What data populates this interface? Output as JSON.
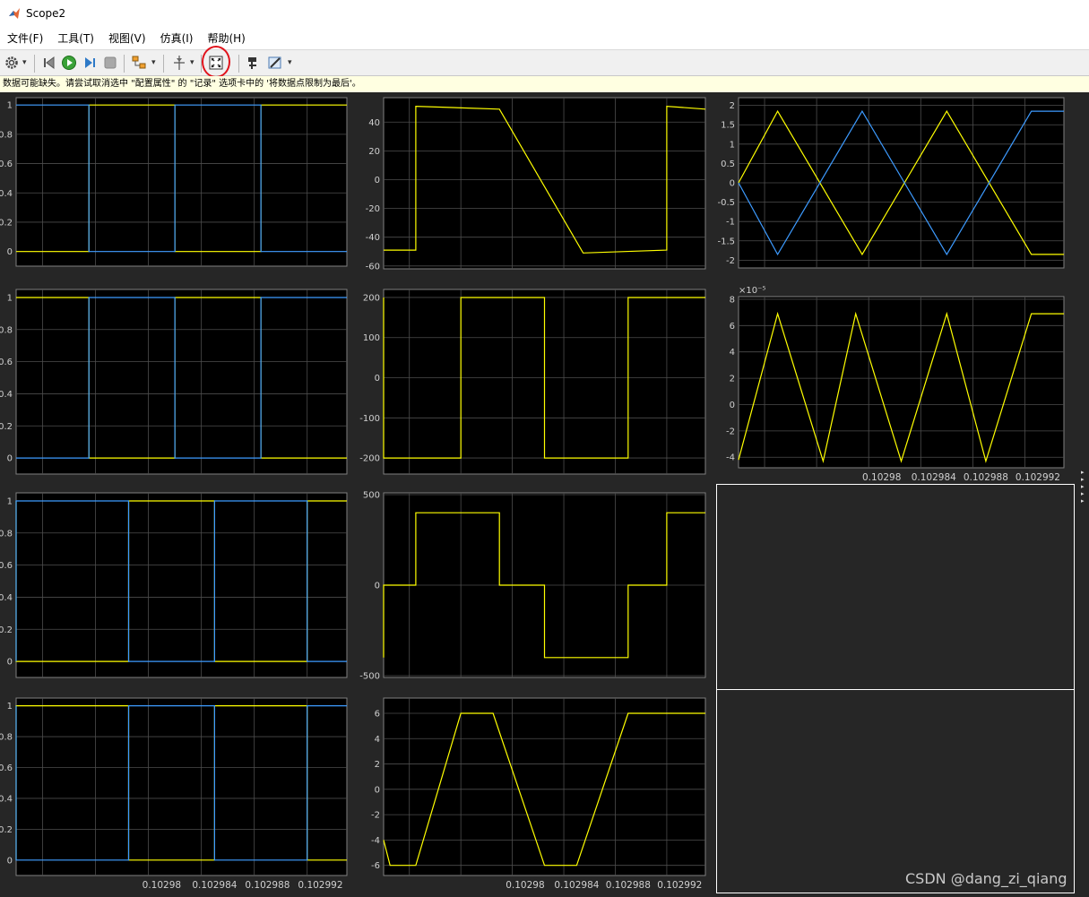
{
  "window": {
    "title": "Scope2"
  },
  "menu": [
    "文件(F)",
    "工具(T)",
    "视图(V)",
    "仿真(I)",
    "帮助(H)"
  ],
  "toolbar": {
    "icons": [
      "gear-icon",
      "step-back-icon",
      "run-icon",
      "step-forward-icon",
      "stop-icon",
      "signal-layout-icon",
      "cursor-measure-icon",
      "zoom-fit-icon",
      "highlight-block-icon",
      "style-icon"
    ]
  },
  "status_message": "数据可能缺失。请尝试取消选中 \"配置属性\" 的 \"记录\" 选项卡中的 '将数据点限制为最后'。",
  "colors": {
    "yellow": "#ffff00",
    "blue": "#3d9bff",
    "plot_bg": "#000000",
    "figure_bg": "#262626",
    "grid": "#4d4d4d",
    "tick_text": "#d0d0d0"
  },
  "watermark": "CSDN @dang_zi_qiang",
  "chart_data": [
    {
      "type": "line",
      "panel": "r1c1",
      "xlim": [
        0.102969,
        0.102994
      ],
      "ylim": [
        -0.1,
        1.05
      ],
      "yticks": [
        0,
        0.2,
        0.4,
        0.6,
        0.8,
        1
      ],
      "ytick_labels": [
        "0",
        "0.2",
        "0.4",
        "0.6",
        "0.8",
        "1"
      ],
      "xtick_labels": [],
      "series": [
        {
          "color": "#ffff00",
          "x": [
            0.102969,
            0.1029745,
            0.1029745,
            0.102981,
            0.102981,
            0.1029875,
            0.1029875,
            0.102994
          ],
          "y": [
            0,
            0,
            1,
            1,
            0,
            0,
            1,
            1
          ]
        },
        {
          "color": "#3d9bff",
          "x": [
            0.102969,
            0.1029745,
            0.1029745,
            0.102981,
            0.102981,
            0.1029875,
            0.1029875,
            0.102994
          ],
          "y": [
            1,
            1,
            0,
            0,
            1,
            1,
            0,
            0
          ]
        }
      ]
    },
    {
      "type": "line",
      "panel": "r1c2",
      "xlim": [
        0.102969,
        0.102994
      ],
      "ylim": [
        -62,
        57
      ],
      "yticks": [
        -60,
        -40,
        -20,
        0,
        20,
        40
      ],
      "ytick_labels": [
        "-60",
        "-40",
        "-20",
        "0",
        "20",
        "40"
      ],
      "xtick_labels": [],
      "series": [
        {
          "color": "#ffff00",
          "x": [
            0.102969,
            0.1029715,
            0.1029715,
            0.102978,
            0.102978,
            0.1029845,
            0.1029845,
            0.102991,
            0.102991,
            0.102994
          ],
          "y": [
            -49,
            -49,
            51,
            49,
            49,
            -51,
            -51,
            -49,
            51,
            49
          ]
        }
      ]
    },
    {
      "type": "line",
      "panel": "r1c3",
      "xlim": [
        0.102969,
        0.102994
      ],
      "ylim": [
        -2.2,
        2.2
      ],
      "yticks": [
        -2,
        -1.5,
        -1,
        -0.5,
        0,
        0.5,
        1,
        1.5,
        2
      ],
      "ytick_labels": [
        "-2",
        "-1.5",
        "-1",
        "-0.5",
        "0",
        "0.5",
        "1",
        "1.5",
        "2"
      ],
      "xtick_labels": [],
      "series": [
        {
          "color": "#ffff00",
          "x": [
            0.102969,
            0.102972,
            0.1029785,
            0.102985,
            0.1029915,
            0.102994
          ],
          "y": [
            0,
            1.85,
            -1.85,
            1.85,
            -1.85,
            -1.85
          ]
        },
        {
          "color": "#3d9bff",
          "x": [
            0.102969,
            0.102972,
            0.1029785,
            0.102985,
            0.1029915,
            0.102994
          ],
          "y": [
            0,
            -1.85,
            1.85,
            -1.85,
            1.85,
            1.85
          ]
        }
      ]
    },
    {
      "type": "line",
      "panel": "r2c1",
      "xlim": [
        0.102969,
        0.102994
      ],
      "ylim": [
        -0.1,
        1.05
      ],
      "yticks": [
        0,
        0.2,
        0.4,
        0.6,
        0.8,
        1
      ],
      "ytick_labels": [
        "0",
        "0.2",
        "0.4",
        "0.6",
        "0.8",
        "1"
      ],
      "xtick_labels": [],
      "series": [
        {
          "color": "#ffff00",
          "x": [
            0.102969,
            0.1029745,
            0.1029745,
            0.102981,
            0.102981,
            0.1029875,
            0.1029875,
            0.102994
          ],
          "y": [
            1,
            1,
            0,
            0,
            1,
            1,
            0,
            0
          ]
        },
        {
          "color": "#3d9bff",
          "x": [
            0.102969,
            0.1029745,
            0.1029745,
            0.102981,
            0.102981,
            0.1029875,
            0.1029875,
            0.102994
          ],
          "y": [
            0,
            0,
            1,
            1,
            0,
            0,
            1,
            1
          ]
        }
      ]
    },
    {
      "type": "line",
      "panel": "r2c2",
      "xlim": [
        0.102969,
        0.102994
      ],
      "ylim": [
        -240,
        220
      ],
      "yticks": [
        -200,
        -100,
        0,
        100,
        200
      ],
      "ytick_labels": [
        "-200",
        "-100",
        "0",
        "100",
        "200"
      ],
      "xtick_labels": [],
      "series": [
        {
          "color": "#ffff00",
          "x": [
            0.102969,
            0.102969,
            0.102975,
            0.102975,
            0.1029815,
            0.1029815,
            0.102988,
            0.102988,
            0.102994
          ],
          "y": [
            200,
            -200,
            -200,
            200,
            200,
            -200,
            -200,
            200,
            200
          ]
        }
      ]
    },
    {
      "type": "line",
      "panel": "r2c3",
      "xlim": [
        0.102969,
        0.102994
      ],
      "ylim": [
        -4.8,
        8.2
      ],
      "exponent_label": "×10⁻⁵",
      "yticks": [
        -4,
        -2,
        0,
        2,
        4,
        6,
        8
      ],
      "ytick_labels": [
        "-4",
        "-2",
        "0",
        "2",
        "4",
        "6",
        "8"
      ],
      "xticks": [
        0.10298,
        0.102984,
        0.102988,
        0.102992
      ],
      "xtick_labels": [
        "0.10298",
        "0.102984",
        "0.102988",
        "0.102992"
      ],
      "series": [
        {
          "color": "#ffff00",
          "x": [
            0.102969,
            0.102972,
            0.1029755,
            0.102978,
            0.1029815,
            0.102985,
            0.102988,
            0.1029915,
            0.102994
          ],
          "y": [
            -4.2,
            6.9,
            -4.3,
            6.9,
            -4.3,
            6.9,
            -4.3,
            6.9,
            6.9
          ]
        }
      ]
    },
    {
      "type": "line",
      "panel": "r3c1",
      "xlim": [
        0.102969,
        0.102994
      ],
      "ylim": [
        -0.1,
        1.05
      ],
      "yticks": [
        0,
        0.2,
        0.4,
        0.6,
        0.8,
        1
      ],
      "ytick_labels": [
        "0",
        "0.2",
        "0.4",
        "0.6",
        "0.8",
        "1"
      ],
      "xtick_labels": [],
      "series": [
        {
          "color": "#ffff00",
          "x": [
            0.102969,
            0.102969,
            0.1029775,
            0.1029775,
            0.102984,
            0.102984,
            0.102991,
            0.102991,
            0.102994
          ],
          "y": [
            1,
            0,
            0,
            1,
            1,
            0,
            0,
            1,
            1
          ]
        },
        {
          "color": "#3d9bff",
          "x": [
            0.102969,
            0.102969,
            0.1029775,
            0.1029775,
            0.102984,
            0.102984,
            0.102991,
            0.102991,
            0.102994
          ],
          "y": [
            0,
            1,
            1,
            0,
            0,
            1,
            1,
            0,
            0
          ]
        }
      ]
    },
    {
      "type": "line",
      "panel": "r3c2",
      "xlim": [
        0.102969,
        0.102994
      ],
      "ylim": [
        -510,
        510
      ],
      "yticks": [
        -500,
        0,
        500
      ],
      "ytick_labels": [
        "-500",
        "0",
        "500"
      ],
      "xtick_labels": [],
      "series": [
        {
          "color": "#ffff00",
          "x": [
            0.102969,
            0.102969,
            0.1029715,
            0.1029715,
            0.102978,
            0.102978,
            0.1029815,
            0.1029815,
            0.102988,
            0.102988,
            0.102991,
            0.102991,
            0.102994
          ],
          "y": [
            -400,
            0,
            0,
            400,
            400,
            0,
            0,
            -400,
            -400,
            0,
            0,
            400,
            400
          ]
        }
      ]
    },
    {
      "type": "line",
      "panel": "r4c1",
      "xlim": [
        0.102969,
        0.102994
      ],
      "ylim": [
        -0.1,
        1.05
      ],
      "yticks": [
        0,
        0.2,
        0.4,
        0.6,
        0.8,
        1
      ],
      "ytick_labels": [
        "0",
        "0.2",
        "0.4",
        "0.6",
        "0.8",
        "1"
      ],
      "xticks": [
        0.10298,
        0.102984,
        0.102988,
        0.102992
      ],
      "xtick_labels": [
        "0.10298",
        "0.102984",
        "0.102988",
        "0.102992"
      ],
      "series": [
        {
          "color": "#ffff00",
          "x": [
            0.102969,
            0.102969,
            0.1029775,
            0.1029775,
            0.102984,
            0.102984,
            0.102991,
            0.102991,
            0.102994
          ],
          "y": [
            0,
            1,
            1,
            0,
            0,
            1,
            1,
            0,
            0
          ]
        },
        {
          "color": "#3d9bff",
          "x": [
            0.102969,
            0.102969,
            0.1029775,
            0.1029775,
            0.102984,
            0.102984,
            0.102991,
            0.102991,
            0.102994
          ],
          "y": [
            1,
            0,
            0,
            1,
            1,
            0,
            0,
            1,
            1
          ]
        }
      ]
    },
    {
      "type": "line",
      "panel": "r4c2",
      "xlim": [
        0.102969,
        0.102994
      ],
      "ylim": [
        -6.8,
        7.2
      ],
      "yticks": [
        -6,
        -4,
        -2,
        0,
        2,
        4,
        6
      ],
      "ytick_labels": [
        "-6",
        "-4",
        "-2",
        "0",
        "2",
        "4",
        "6"
      ],
      "xticks": [
        0.10298,
        0.102984,
        0.102988,
        0.102992
      ],
      "xtick_labels": [
        "0.10298",
        "0.102984",
        "0.102988",
        "0.102992"
      ],
      "series": [
        {
          "color": "#ffff00",
          "x": [
            0.102969,
            0.1029695,
            0.1029715,
            0.102975,
            0.1029775,
            0.1029815,
            0.102984,
            0.102988,
            0.1029905,
            0.102994
          ],
          "y": [
            -4,
            -6,
            -6,
            6,
            6,
            -6,
            -6,
            6,
            6,
            6
          ]
        }
      ]
    }
  ]
}
